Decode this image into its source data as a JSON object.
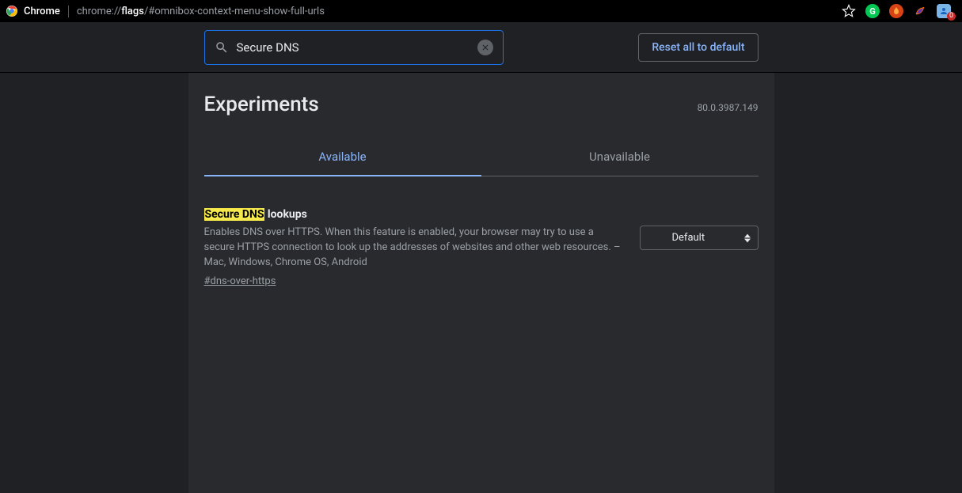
{
  "toolbar": {
    "app_name": "Chrome",
    "url_prefix": "chrome://",
    "url_bold": "flags",
    "url_suffix": "/#omnibox-context-menu-show-full-urls",
    "ext_badge": "0"
  },
  "header": {
    "search_value": "Secure DNS",
    "reset_label": "Reset all to default"
  },
  "page": {
    "title": "Experiments",
    "version": "80.0.3987.149",
    "tabs": {
      "available": "Available",
      "unavailable": "Unavailable"
    }
  },
  "flag": {
    "title_highlight": "Secure DNS",
    "title_rest": " lookups",
    "description": "Enables DNS over HTTPS. When this feature is enabled, your browser may try to use a secure HTTPS connection to look up the addresses of websites and other web resources. – Mac, Windows, Chrome OS, Android",
    "link": "#dns-over-https",
    "select_value": "Default"
  }
}
